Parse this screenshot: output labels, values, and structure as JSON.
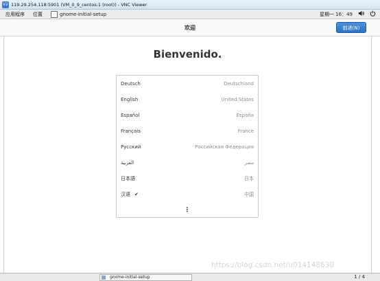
{
  "vnc": {
    "title": "119.29.254.118:5901 (VM_0_9_centos:1 (root)) - VNC Viewer",
    "icon_label": "V2"
  },
  "topbar": {
    "menu": [
      "应用程序",
      "位置",
      "gnome-initial-setup"
    ],
    "clock": "星期一 16：49",
    "icons": [
      "volume-icon",
      "power-icon"
    ]
  },
  "header": {
    "title": "欢迎",
    "next_label": "前进(N)",
    "accent": "#2c72c7"
  },
  "welcome": "Bienvenido.",
  "languages": [
    {
      "name": "Deutsch",
      "region": "Deutschland",
      "selected": false
    },
    {
      "name": "English",
      "region": "United States",
      "selected": false
    },
    {
      "name": "Español",
      "region": "España",
      "selected": false
    },
    {
      "name": "Français",
      "region": "France",
      "selected": false
    },
    {
      "name": "Русский",
      "region": "Российская Федерация",
      "selected": false
    },
    {
      "name": "العربية",
      "region": "مصر",
      "selected": false
    },
    {
      "name": "日本語",
      "region": "日本",
      "selected": false
    },
    {
      "name": "汉语",
      "region": "中国",
      "selected": true
    }
  ],
  "more_label": "⋮",
  "taskbar": {
    "task_label": "gnome-initial-setup",
    "pager": "1 / 4"
  },
  "watermark": "https://blog.csdn.net/u014148630"
}
